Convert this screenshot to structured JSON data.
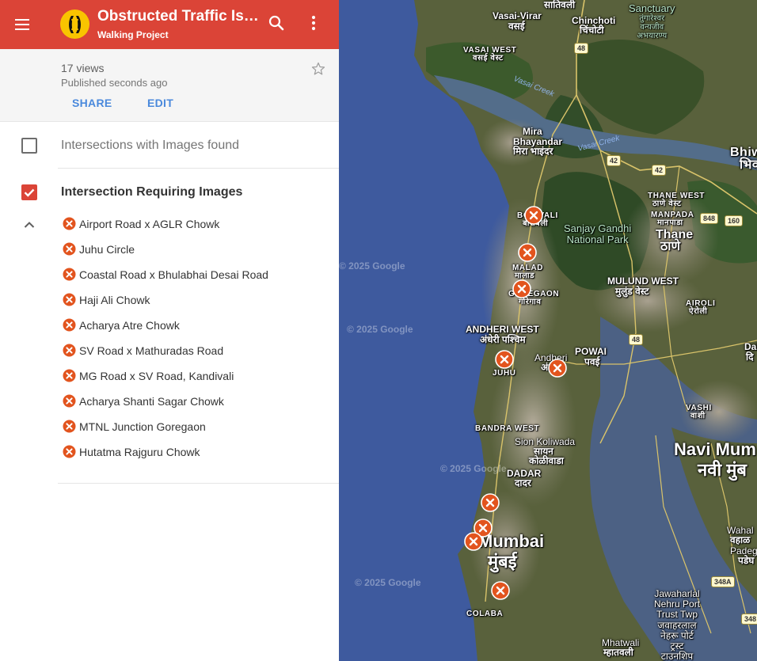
{
  "header": {
    "title": "Obstructed Traffic Isla…",
    "subtitle": "Walking Project",
    "menu_icon": "menu-icon",
    "search_icon": "search-icon",
    "more_icon": "more-vert-icon",
    "color": "#db4437"
  },
  "meta": {
    "views": "17 views",
    "published": "Published seconds ago",
    "share_label": "SHARE",
    "edit_label": "EDIT",
    "star_icon": "star-outline-icon"
  },
  "layers": [
    {
      "name": "Intersections with Images found",
      "checked": false
    },
    {
      "name": "Intersection Requiring Images",
      "checked": true,
      "expanded": true,
      "pin_color": "#e2541e",
      "places": [
        "Airport Road x AGLR Chowk",
        "Juhu Circle",
        "Coastal Road x Bhulabhai Desai Road",
        "Haji Ali Chowk",
        "Acharya Atre Chowk",
        "SV Road x Mathuradas Road",
        "MG Road x SV Road, Kandivali",
        "Acharya Shanti Sagar Chowk",
        "MTNL Junction Goregaon",
        "Hutatma Rajguru Chowk"
      ]
    }
  ],
  "map": {
    "labels": {
      "vasai_virar": "Vasai-Virar",
      "vasai_virar_mr": "वसई",
      "satiwali": "सातिवली",
      "chinchoti": "Chinchoti",
      "chinchoti_mr": "चिंचोटी",
      "sanctuary": "Sanctuary",
      "sanctuary_mr1": "तुंगारेश्वर",
      "sanctuary_mr2": "वन्यजीव",
      "sanctuary_mr3": "अभयारण्य",
      "vasai_west": "VASAI WEST",
      "vasai_west_mr": "वसई वेस्ट",
      "vasai_creek_1": "Vasai Creek",
      "vasai_creek_2": "Vasai Creek",
      "mira": "Mira",
      "bhayandar": "Bhayandar",
      "mira_mr": "मिरा भाइंदर",
      "bhiwandi": "Bhiwa",
      "bhiwandi_mr": "भिव",
      "borivali": "BORIVALI",
      "borivali_mr": "बोरीवली",
      "sgnp_1": "Sanjay Gandhi",
      "sgnp_2": "National Park",
      "thane_west": "THANE WEST",
      "thane_west_mr": "ठाणे वेस्ट",
      "manpada": "MANPADA",
      "manpada_mr": "मानपाडा",
      "thane": "Thane",
      "thane_mr": "ठाणे",
      "malad": "MALAD",
      "malad_mr": "मालाड",
      "goregaon": "GOREGAON",
      "goregaon_mr": "गोरेगाव",
      "mulund_west": "MULUND WEST",
      "mulund_west_mr": "मुलुंड वेस्ट",
      "airoli": "AIROLI",
      "airoli_mr": "ऐरोली",
      "andheri_west": "ANDHERI WEST",
      "andheri_west_mr": "अंधेरी पश्चिम",
      "powai": "POWAI",
      "powai_mr": "पवई",
      "andheri": "Andheri",
      "andheri_mr": "अं",
      "juhu": "JUHU",
      "dahisar": "Dah",
      "dahisar_mr": "दि",
      "vashi": "VASHI",
      "vashi_mr": "वाशी",
      "bandra_west": "BANDRA WEST",
      "sion_koliwada": "Sion Koliwada",
      "sion_koliwada_mr1": "सायन",
      "sion_koliwada_mr2": "कोळीवाडा",
      "navi_mumbai": "Navi Mum",
      "navi_mumbai_mr": "नवी मुंब",
      "dadar": "DADAR",
      "dadar_mr": "दादर",
      "mumbai": "Mumbai",
      "mumbai_mr": "मुंबई",
      "wahal": "Wahal",
      "wahal_mr": "वहाळ",
      "padeghar": "Padeg",
      "padeghar_mr": "पडेघ",
      "colaba": "COLABA",
      "jnpt_1": "Jawaharlal",
      "jnpt_2": "Nehru Port",
      "jnpt_3": "Trust Twp",
      "jnpt_mr1": "जवाहरलाल",
      "jnpt_mr2": "नेहरू पोर्ट",
      "jnpt_mr3": "ट्रस्ट",
      "jnpt_mr4": "टाउनशिप",
      "mhatwali": "Mhatwali",
      "mhatwali_mr": "म्हातवली"
    },
    "highways": [
      "48",
      "42",
      "42",
      "848",
      "160",
      "48",
      "348A",
      "348"
    ],
    "watermark": "© 2025 Google"
  }
}
